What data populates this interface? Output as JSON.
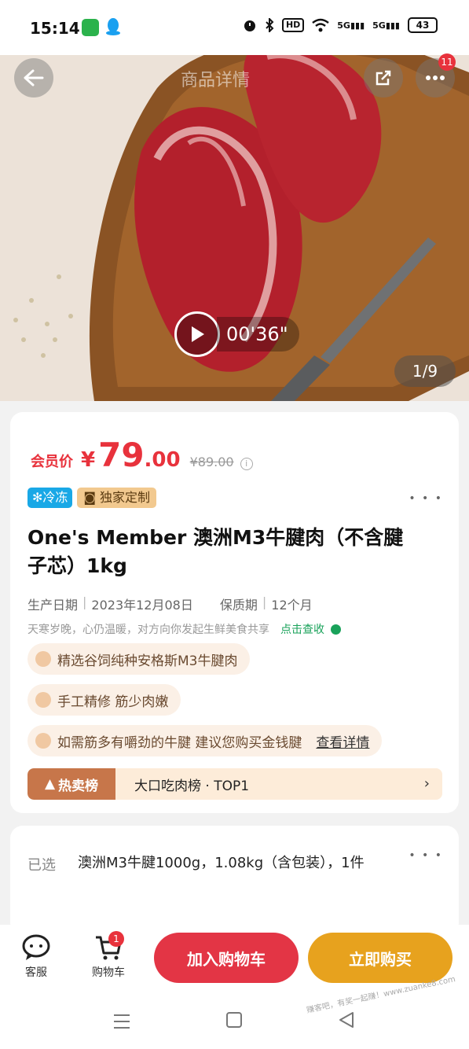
{
  "status_bar": {
    "time": "15:14",
    "hd_label": "HD",
    "net1": "5G",
    "net2": "5G",
    "battery": "43"
  },
  "header": {
    "title": "商品详情",
    "message_badge": "11"
  },
  "media": {
    "video_duration": "00'36\"",
    "page_indicator": "1/9"
  },
  "price": {
    "member_label": "会员价",
    "currency": "¥",
    "integer": "79",
    "decimal": ".00",
    "original": "¥89.00"
  },
  "tags": {
    "frozen": "冷冻",
    "exclusive": "独家定制"
  },
  "product": {
    "title": "One's Member 澳洲M3牛腱肉（不含腱子芯）1kg",
    "production_label": "生产日期",
    "production_date": "2023年12月08日",
    "shelf_label": "保质期",
    "shelf_life": "12个月",
    "slogan": "天寒岁晚，心仍温暖，对方向你发起生鲜美食共享",
    "slogan_link": "点击查收"
  },
  "features": [
    {
      "text": "精选谷饲纯种安格斯M3牛腱肉"
    },
    {
      "text": "手工精修 筋少肉嫩"
    },
    {
      "text": "如需筋多有嚼劲的牛腱 建议您购买金钱腱",
      "link": "查看详情"
    }
  ],
  "ranking": {
    "label": "热卖榜",
    "text": "大口吃肉榜 · TOP1"
  },
  "selection": {
    "label": "已选",
    "value": "澳洲M3牛腱1000g，1.08kg（含包装），1件"
  },
  "bottom_bar": {
    "service_label": "客服",
    "cart_label": "购物车",
    "cart_badge": "1",
    "add_to_cart": "加入购物车",
    "buy_now": "立即购买"
  },
  "watermark": "赚客吧，有奖一起赚！www.zuanke8.com",
  "colors": {
    "accent_red": "#e33545",
    "accent_orange": "#e7a21e",
    "link_green": "#19a25a",
    "frozen_blue": "#19a8e6"
  }
}
